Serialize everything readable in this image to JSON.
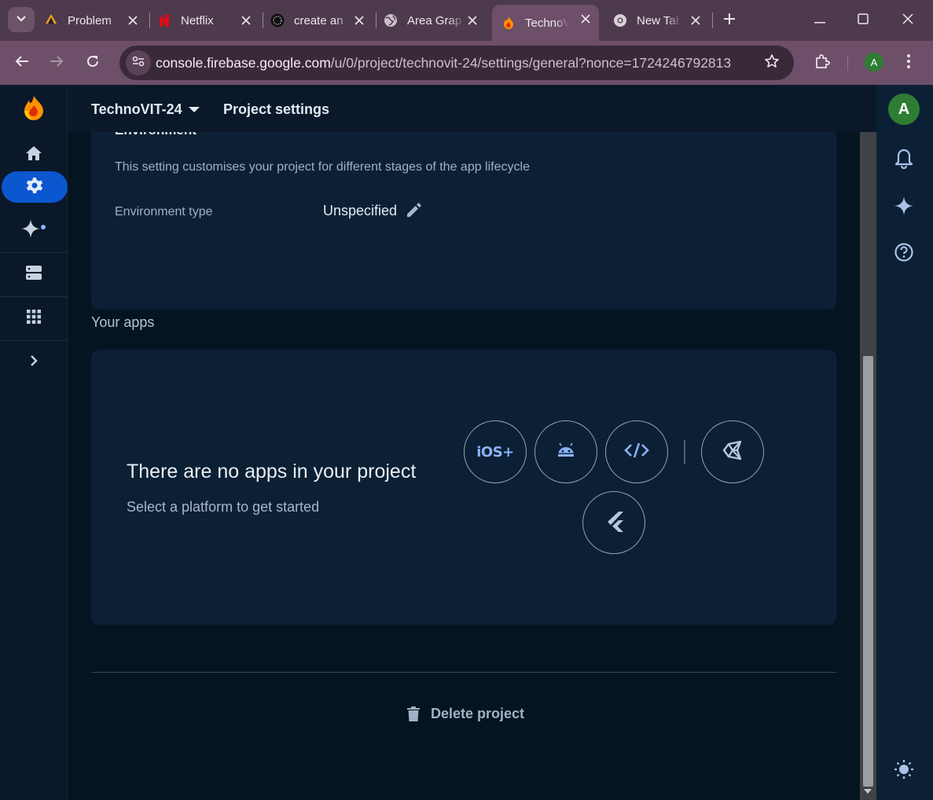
{
  "browser": {
    "tabs": [
      {
        "title": "Problem",
        "icon": "codeforces-favicon"
      },
      {
        "title": "Netflix",
        "icon": "netflix-favicon"
      },
      {
        "title": "create an",
        "icon": "dotted-circle-favicon"
      },
      {
        "title": "Area Grap",
        "icon": "globe-favicon"
      },
      {
        "title": "TechnoVIT",
        "icon": "firebase-favicon",
        "active": true
      },
      {
        "title": "New Tab",
        "icon": "chrome-favicon"
      }
    ],
    "url_host": "console.firebase.google.com",
    "url_path": "/u/0/project/technovit-24/settings/general?nonce=1724246792813",
    "profile_initial": "A"
  },
  "header": {
    "project_name": "TechnoVIT-24",
    "page_title": "Project settings"
  },
  "environment": {
    "heading": "Environment",
    "description": "This setting customises your project for different stages of the app lifecycle",
    "type_label": "Environment type",
    "type_value": "Unspecified"
  },
  "apps": {
    "heading": "Your apps",
    "empty_title": "There are no apps in your project",
    "empty_subtitle": "Select a platform to get started",
    "platforms": [
      "iOS+",
      "Android",
      "Web",
      "Unity",
      "Flutter"
    ]
  },
  "danger": {
    "delete_label": "Delete project"
  },
  "user": {
    "avatar_initial": "A"
  },
  "colors": {
    "accent": "#0b57d0",
    "background": "#041421",
    "card": "#0c2035",
    "link": "#8ab4f8"
  }
}
